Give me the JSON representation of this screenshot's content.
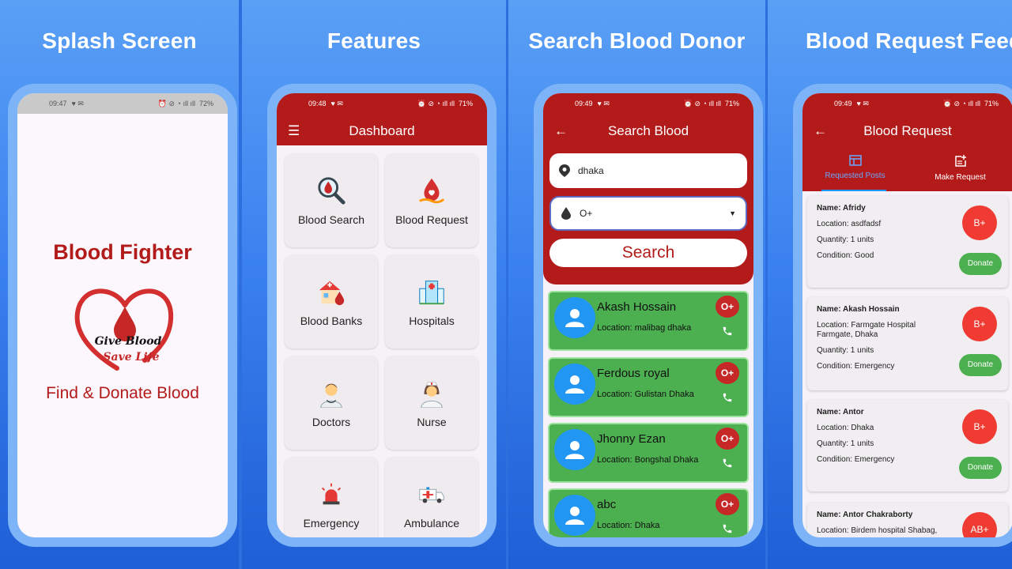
{
  "panels": {
    "splash": {
      "heading": "Splash Screen"
    },
    "features": {
      "heading": "Features"
    },
    "search": {
      "heading": "Search Blood Donor"
    },
    "feed": {
      "heading": "Blood Request Feed"
    }
  },
  "status_bars": {
    "splash": {
      "time": "09:47",
      "battery": "72%"
    },
    "dashboard": {
      "time": "09:48",
      "battery": "71%"
    },
    "search": {
      "time": "09:49",
      "battery": "71%"
    },
    "feed": {
      "time": "09:49",
      "battery": "71%"
    }
  },
  "splash": {
    "app_name": "Blood Fighter",
    "logo_line1": "Give Blood",
    "logo_line2": "Save Life",
    "tagline": "Find & Donate Blood"
  },
  "dashboard": {
    "title": "Dashboard",
    "menu_icon": "hamburger-icon",
    "items": [
      {
        "label": "Blood Search",
        "icon": "blood-search-icon"
      },
      {
        "label": "Blood Request",
        "icon": "blood-request-icon"
      },
      {
        "label": "Blood Banks",
        "icon": "blood-bank-icon"
      },
      {
        "label": "Hospitals",
        "icon": "hospital-icon"
      },
      {
        "label": "Doctors",
        "icon": "doctor-icon"
      },
      {
        "label": "Nurse",
        "icon": "nurse-icon"
      },
      {
        "label": "Emergency",
        "icon": "siren-icon"
      },
      {
        "label": "Ambulance",
        "icon": "ambulance-icon"
      }
    ]
  },
  "search": {
    "title": "Search Blood",
    "location_value": "dhaka",
    "blood_group_value": "O+",
    "search_button": "Search",
    "donors": [
      {
        "name": "Akash Hossain",
        "location": "Location: malibag dhaka",
        "group": "O+"
      },
      {
        "name": "Ferdous royal",
        "location": "Location: Gulistan Dhaka",
        "group": "O+"
      },
      {
        "name": "Jhonny Ezan",
        "location": "Location: Bongshal Dhaka",
        "group": "O+"
      },
      {
        "name": "abc",
        "location": "Location: Dhaka",
        "group": "O+"
      }
    ]
  },
  "feed": {
    "title": "Blood Request",
    "tabs": [
      {
        "label": "Requested Posts",
        "icon": "table-icon"
      },
      {
        "label": "Make Request",
        "icon": "post-add-icon"
      }
    ],
    "donate_label": "Donate",
    "requests": [
      {
        "name": "Name: Afridy",
        "location": "Location: asdfadsf",
        "quantity": "Quantity: 1 units",
        "condition": "Condition: Good",
        "group": "B+"
      },
      {
        "name": "Name: Akash Hossain",
        "location": "Location: Farmgate Hospital Farmgate, Dhaka",
        "quantity": "Quantity: 1 units",
        "condition": "Condition: Emergency",
        "group": "B+"
      },
      {
        "name": "Name: Antor",
        "location": "Location: Dhaka",
        "quantity": "Quantity: 1 units",
        "condition": "Condition: Emergency",
        "group": "B+"
      },
      {
        "name": "Name: Antor Chakraborty",
        "location": "Location: Birdem hospital Shabag,",
        "group": "AB+"
      }
    ]
  },
  "colors": {
    "brand_red": "#b31b1b",
    "donor_green": "#4caf50",
    "badge_red": "#c62828",
    "accent_blue": "#2196f3"
  }
}
